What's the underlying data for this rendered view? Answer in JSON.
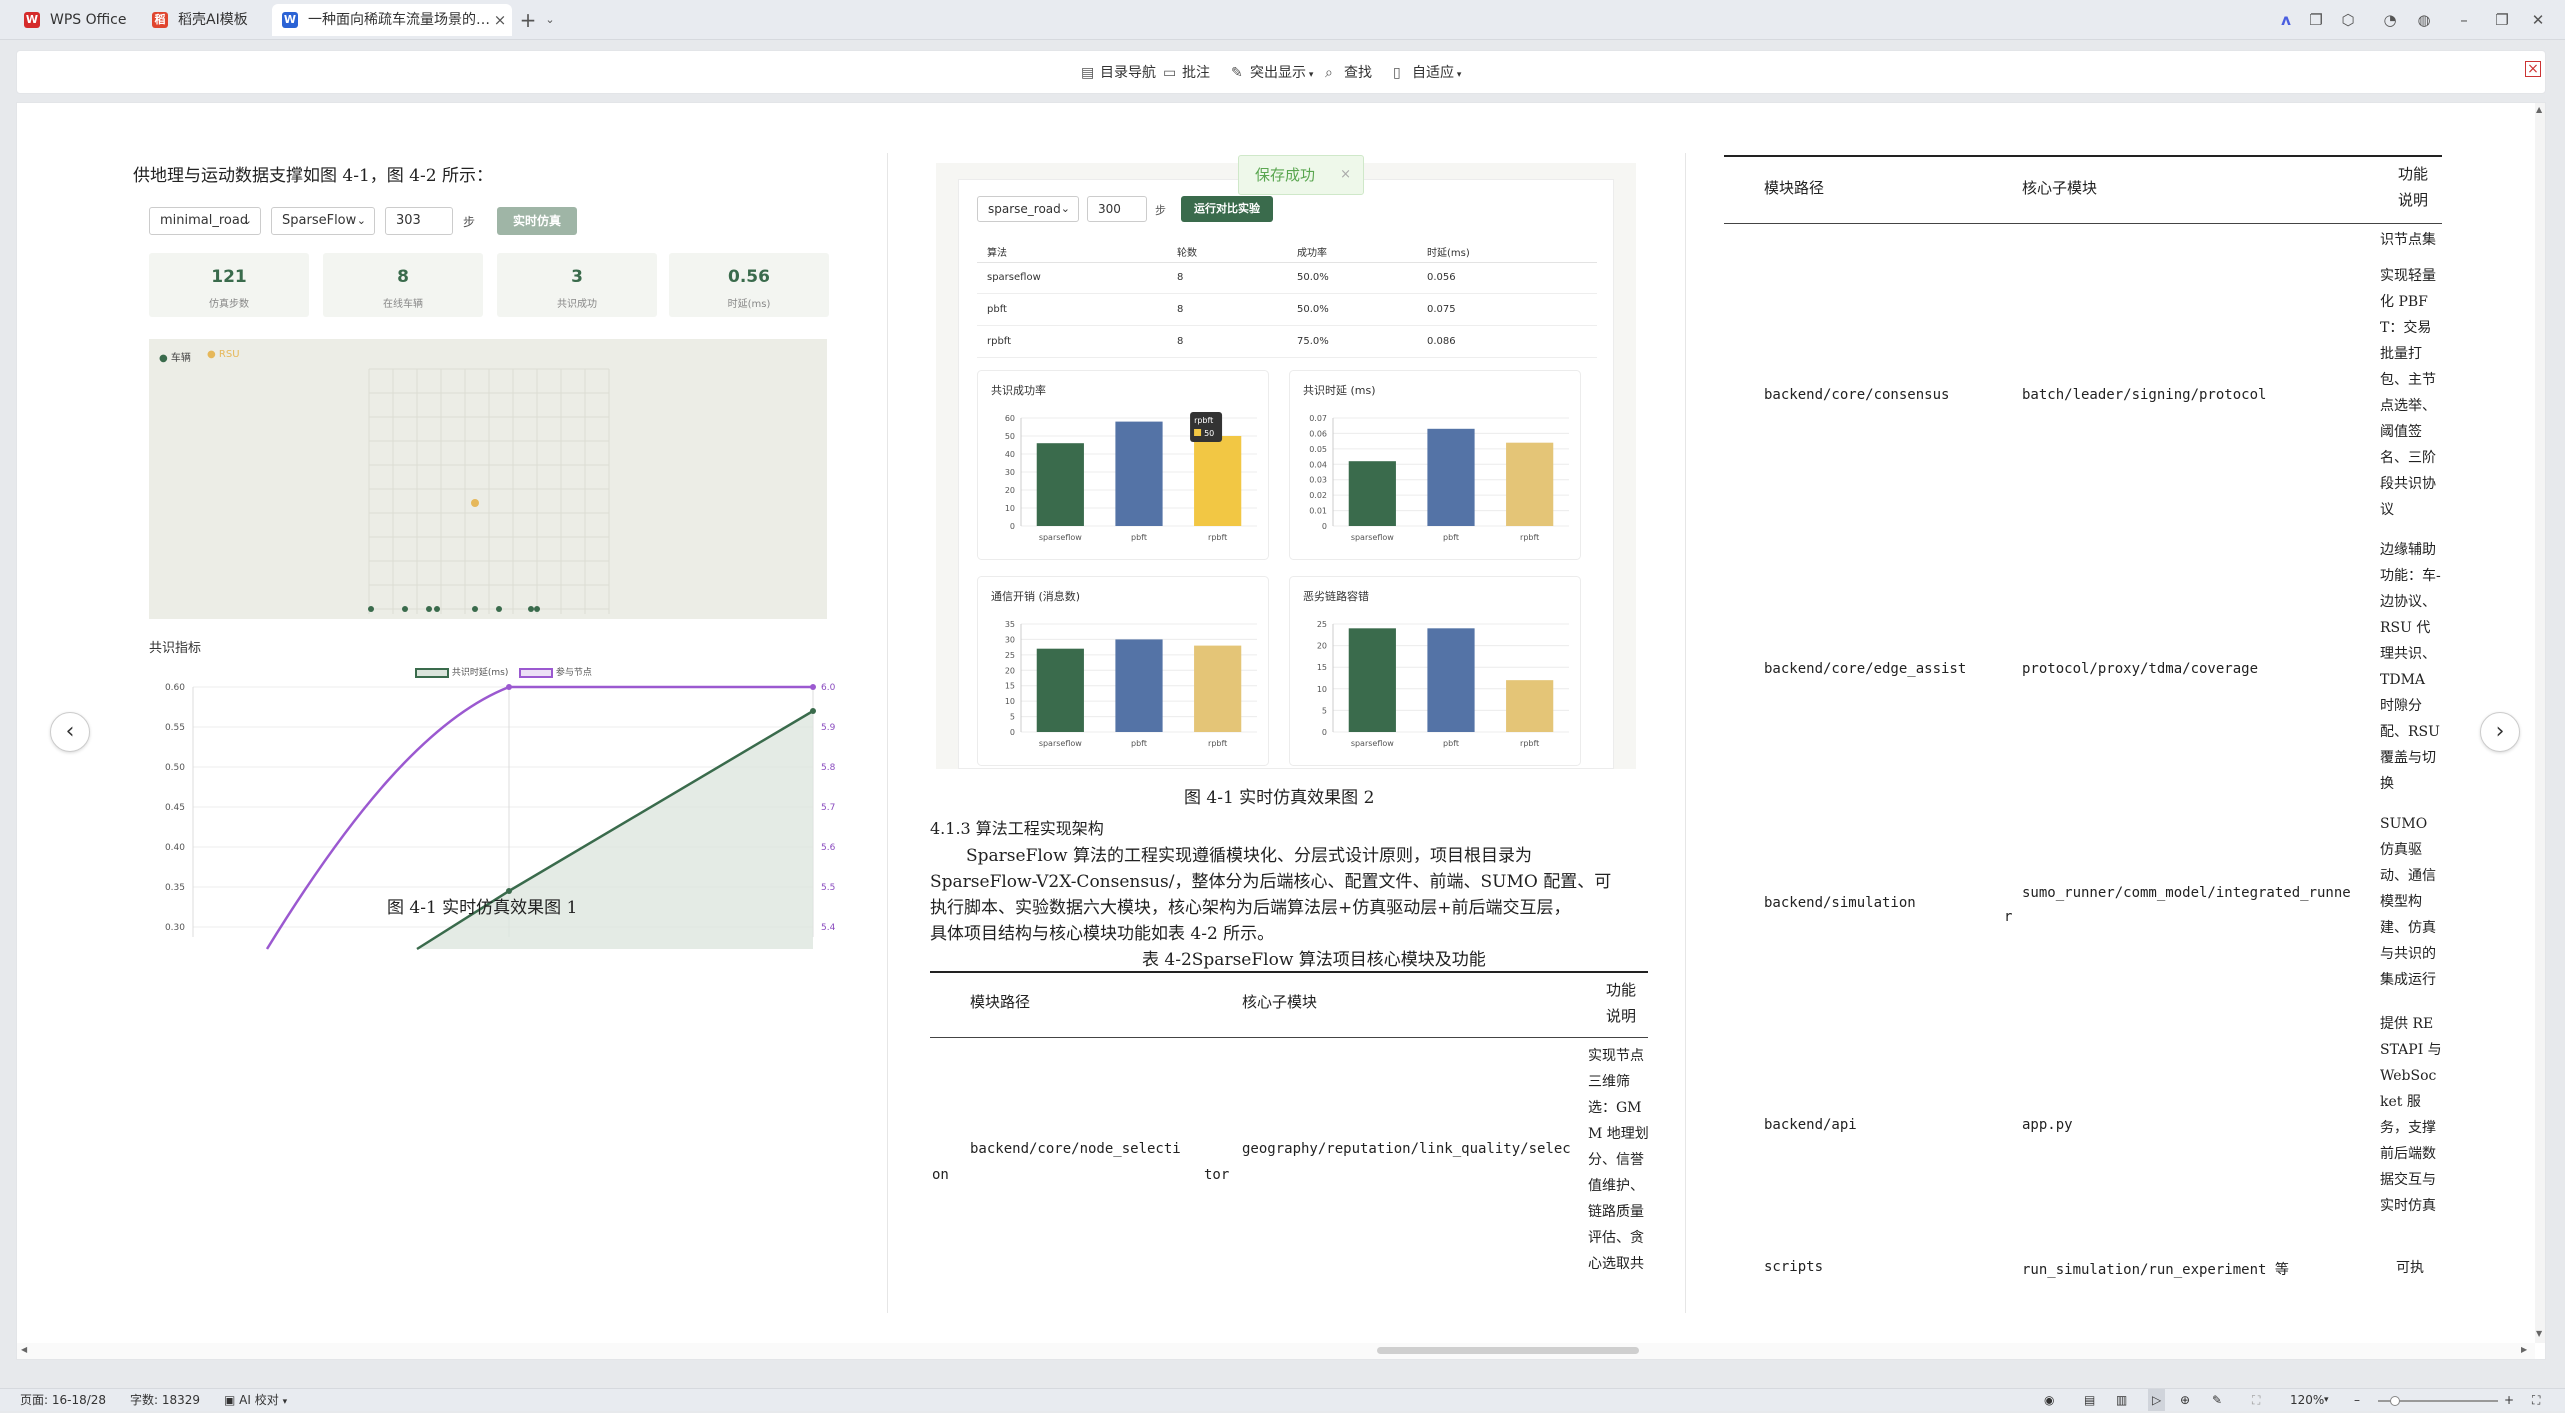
{
  "tabs": [
    {
      "label": "WPS Office",
      "icon": "W",
      "color": "#d52b2b"
    },
    {
      "label": "稻壳AI模板",
      "icon": "稻",
      "color": "#e0452e"
    },
    {
      "label": "一种面向稀疏车流量场景的…",
      "icon": "W",
      "color": "#2b63d5"
    }
  ],
  "toolbar": {
    "nav": "目录导航",
    "annotate": "批注",
    "highlight": "突出显示",
    "find": "查找",
    "fit": "自适应"
  },
  "page1": {
    "intro": "供地理与运动数据支撑如图 4-1，图 4-2 所示：",
    "sim": {
      "road": "minimal_road",
      "algo": "SparseFlow",
      "steps": "303",
      "steps_unit": "步",
      "run": "实时仿真",
      "stats": [
        {
          "value": "121",
          "label": "仿真步数"
        },
        {
          "value": "8",
          "label": "在线车辆"
        },
        {
          "value": "3",
          "label": "共识成功"
        },
        {
          "value": "0.56",
          "label": "时延(ms)"
        }
      ],
      "legend_vehicle": "车辆",
      "legend_rsu": "RSU",
      "metrics_title": "共识指标",
      "legend_latency": "共识时延(ms)",
      "legend_nodes": "参与节点",
      "left_ticks": [
        "0.60",
        "0.55",
        "0.50",
        "0.45",
        "0.40",
        "0.35",
        "0.30"
      ],
      "right_ticks": [
        "6.0",
        "5.9",
        "5.8",
        "5.7",
        "5.6",
        "5.5",
        "5.4"
      ]
    },
    "caption": "图 4-1 实时仿真效果图 1"
  },
  "page2": {
    "toast": "保存成功",
    "toast_close": "×",
    "road": "sparse_road",
    "steps": "300",
    "steps_unit": "步",
    "run": "运行对比实验",
    "table_headers": [
      "算法",
      "轮数",
      "成功率",
      "时延(ms)"
    ],
    "table_rows": [
      [
        "sparseflow",
        "8",
        "50.0%",
        "0.056"
      ],
      [
        "pbft",
        "8",
        "50.0%",
        "0.075"
      ],
      [
        "rpbft",
        "8",
        "75.0%",
        "0.086"
      ]
    ],
    "tooltip_name": "rpbft",
    "tooltip_value": "50",
    "charts": [
      {
        "title": "共识成功率",
        "ticks": [
          "60",
          "50",
          "40",
          "30",
          "20",
          "10",
          "0"
        ],
        "max": 60,
        "values": [
          46,
          58,
          50
        ],
        "highlight": 2
      },
      {
        "title": "共识时延 (ms)",
        "ticks": [
          "0.07",
          "0.06",
          "0.05",
          "0.04",
          "0.03",
          "0.02",
          "0.01",
          "0"
        ],
        "max": 0.07,
        "values": [
          0.042,
          0.063,
          0.054
        ],
        "highlight": -1
      },
      {
        "title": "通信开销 (消息数)",
        "ticks": [
          "35",
          "30",
          "25",
          "20",
          "15",
          "10",
          "5",
          "0"
        ],
        "max": 35,
        "values": [
          27,
          30,
          28
        ],
        "highlight": -1
      },
      {
        "title": "恶劣链路容错",
        "ticks": [
          "25",
          "20",
          "15",
          "10",
          "5",
          "0"
        ],
        "max": 25,
        "values": [
          24,
          24,
          12
        ],
        "highlight": -1
      }
    ],
    "categories": [
      "sparseflow",
      "pbft",
      "rpbft"
    ],
    "caption": "图 4-1 实时仿真效果图 2",
    "section": "4.1.3 算法工程实现架构",
    "para": [
      "SparseFlow 算法的工程实现遵循模块化、分层式设计原则，项目根目录为",
      "SparseFlow-V2X-Consensus/，整体分为后端核心、配置文件、前端、SUMO 配置、可",
      "执行脚本、实验数据六大模块，核心架构为后端算法层+仿真驱动层+前后端交互层，",
      "具体项目结构与核心模块功能如表 4-2 所示。"
    ],
    "table_title": "表 4-2SparseFlow 算法项目核心模块及功能",
    "th": [
      "模块路径",
      "核心子模块",
      "功能说明"
    ],
    "row1": {
      "path1": "backend/core/node_selecti",
      "path2": "on",
      "sub1": "geography/reputation/link_quality/selec",
      "sub2": "tor",
      "desc": "实现节点三维筛选：GMM 地理划分、信誉值维护、链路质量评估、贪心选取共"
    }
  },
  "page3": {
    "th": [
      "模块路径",
      "核心子模块",
      "功能说明"
    ],
    "carry": "识节点集",
    "rows": [
      {
        "path": "backend/core/consensus",
        "sub": "batch/leader/signing/protocol",
        "desc": "实现轻量化 PBFT：交易批量打包、主节点选举、阈值签名、三阶段共识协议"
      },
      {
        "path": "backend/core/edge_assist",
        "sub": "protocol/proxy/tdma/coverage",
        "desc": "边缘辅助功能：车-边协议、RSU 代理共识、TDMA 时隙分配、RSU 覆盖与切换"
      },
      {
        "path": "backend/simulation",
        "sub": "sumo_runner/comm_model/integrated_runne",
        "sub2": "r",
        "desc": "SUMO 仿真驱动、通信模型构建、仿真与共识的集成运行"
      },
      {
        "path": "backend/api",
        "sub": "app.py",
        "desc": "提供 RESTAPI 与 WebSocket 服务，支撑前后端数据交互与实时仿真"
      },
      {
        "path": "scripts",
        "sub": "run_simulation/run_experiment 等",
        "desc": "可执"
      }
    ]
  },
  "status": {
    "page": "页面: 16-18/28",
    "words": "字数: 18329",
    "ai": "AI 校对",
    "zoom": "120%"
  }
}
